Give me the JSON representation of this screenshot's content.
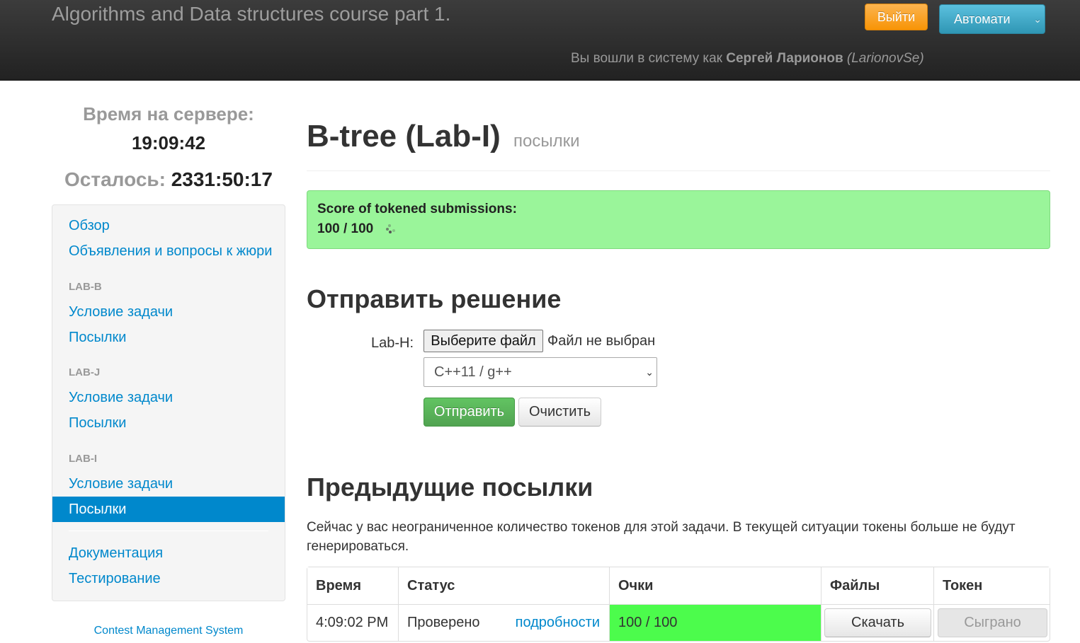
{
  "header": {
    "brand": "Algorithms and Data structures course part 1.",
    "logout_label": "Выйти",
    "auto_label": "Автомати",
    "login_prefix": "Вы вошли в систему как",
    "user_fullname": "Сергей Ларионов",
    "user_login": "(LarionovSe)"
  },
  "sidebar": {
    "server_time_label": "Время на сервере:",
    "server_time": "19:09:42",
    "remaining_label": "Осталось:",
    "remaining_value": "2331:50:17",
    "overview": "Обзор",
    "announcements": "Объявления и вопросы к жюри",
    "sections": [
      {
        "header": "LAB-B",
        "statement": "Условие задачи",
        "submissions": "Посылки"
      },
      {
        "header": "LAB-J",
        "statement": "Условие задачи",
        "submissions": "Посылки"
      },
      {
        "header": "LAB-I",
        "statement": "Условие задачи",
        "submissions": "Посылки"
      }
    ],
    "documentation": "Документация",
    "testing": "Тестирование",
    "footer": "Contest Management System"
  },
  "main": {
    "title": "B-tree (Lab-I)",
    "subtitle": "посылки",
    "score_label": "Score of tokened submissions:",
    "score_value": "100 / 100",
    "submit_heading": "Отправить решение",
    "file_label": "Lab-H:",
    "file_button": "Выберите файл",
    "file_status": "Файл не выбран",
    "language_selected": "C++11 / g++",
    "send_label": "Отправить",
    "clear_label": "Очистить",
    "prev_heading": "Предыдущие посылки",
    "tokens_note": "Сейчас у вас неограниченное количество токенов для этой задачи. В текущей ситуации токены больше не будут генерироваться."
  },
  "table": {
    "headers": [
      "Время",
      "Статус",
      "Очки",
      "Файлы",
      "Токен"
    ],
    "rows": [
      {
        "time": "4:09:02 PM",
        "status": "Проверено",
        "details": "подробности",
        "score": "100 / 100",
        "download": "Скачать",
        "token": "Сыграно"
      }
    ]
  },
  "colors": {
    "accent": "#0088cc",
    "score_box": "#9af59a",
    "score_cell": "#4cfc4c",
    "logout": "#f89406",
    "auto": "#2f96b4",
    "send": "#51a351"
  },
  "icons": {
    "caret": "chevron-down-icon",
    "spinner": "loading-spinner-icon"
  }
}
